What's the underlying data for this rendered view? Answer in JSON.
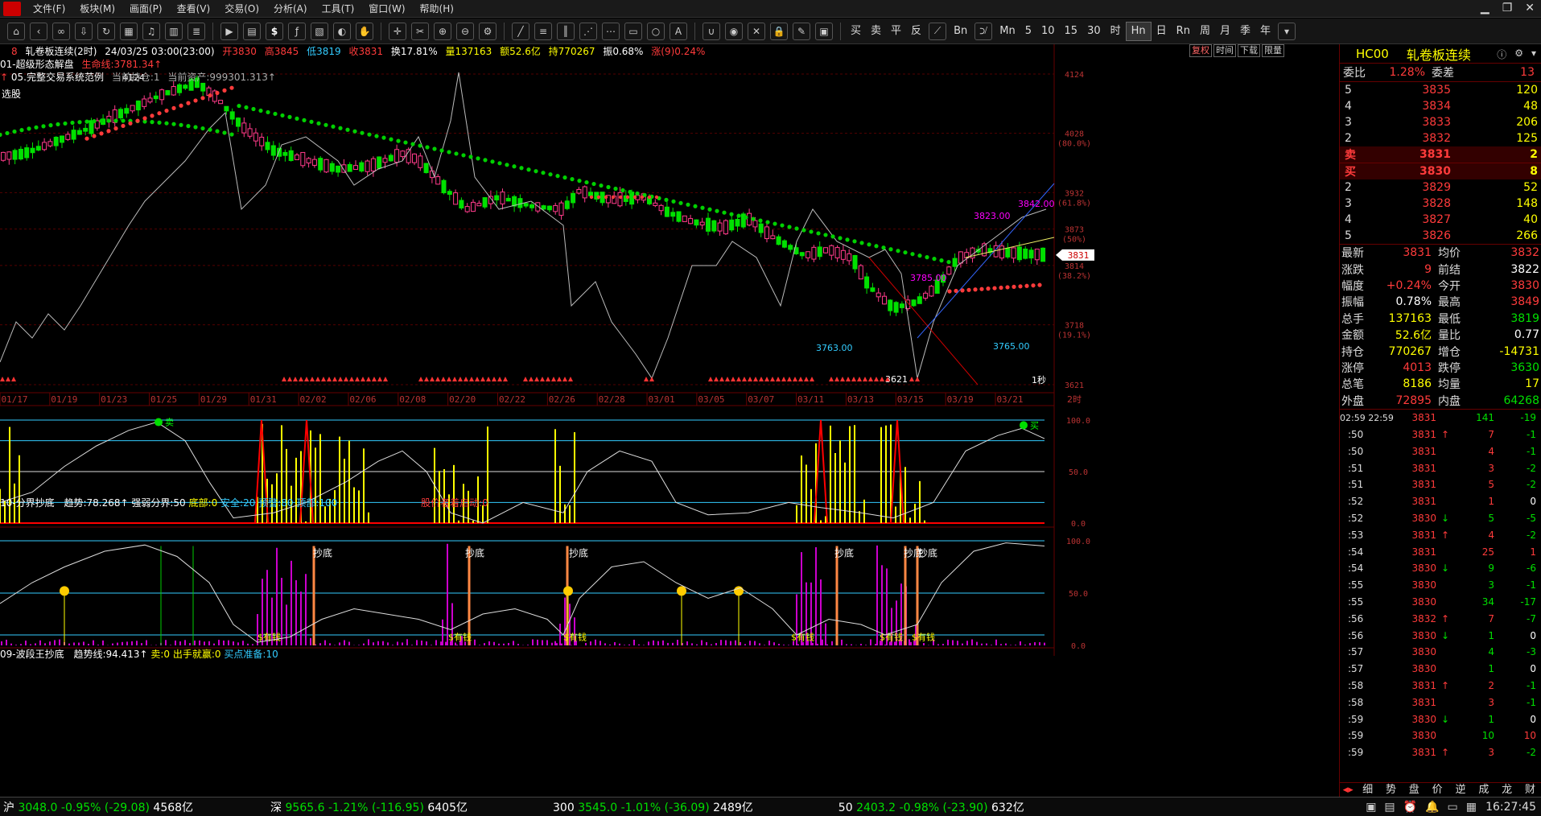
{
  "menu": [
    "文件(F)",
    "板块(M)",
    "画面(P)",
    "查看(V)",
    "交易(O)",
    "分析(A)",
    "工具(T)",
    "窗口(W)",
    "帮助(H)"
  ],
  "toolbar": {
    "periods": [
      "Mn",
      "5",
      "10",
      "15",
      "30",
      "时",
      "Hn",
      "日",
      "Rn",
      "周",
      "月",
      "季",
      "年"
    ],
    "active_period": "Hn",
    "trade": [
      "买",
      "卖",
      "平",
      "反"
    ],
    "quote_icon": "Bn"
  },
  "title": {
    "num": "8",
    "name": "轧卷板连续(2时)",
    "datetime": "24/03/25 03:00(23:00)",
    "open": "开3830",
    "high": "高3845",
    "low": "低3819",
    "close": "收3831",
    "turnover": "换17.81%",
    "volume": "量137163",
    "amount": "额52.6亿",
    "oi": "持770267",
    "amplitude": "振0.68%",
    "change": "涨(9)0.24%"
  },
  "chart_tabs": [
    "复权",
    "时间",
    "下载",
    "限量"
  ],
  "indicator1": {
    "name": "01-超级形态解盘",
    "life": "生命线:3781.34"
  },
  "indicator2": {
    "name": "05.完整交易系统范例",
    "pos": "当前持仓:1",
    "asset": "当前资产:999301.313"
  },
  "xuangu": "选股",
  "price_axis": [
    {
      "v": "4124",
      "p": ""
    },
    {
      "v": "4028",
      "p": "(80.0%)"
    },
    {
      "v": "3932",
      "p": "(61.8%)"
    },
    {
      "v": "3873",
      "p": "(50%)"
    },
    {
      "v": "3814",
      "p": "(38.2%)"
    },
    {
      "v": "3718",
      "p": "(19.1%)"
    },
    {
      "v": "3621",
      "p": ""
    }
  ],
  "current_price_tag": "3831",
  "annotations": {
    "high": "4124",
    "low": "3621",
    "a1": "3763.00",
    "a2": "3765.00",
    "a3": "3823.00",
    "a4": "3842.00",
    "a5": "3785.00",
    "sec": "1秒"
  },
  "dates": [
    "01/17",
    "01/19",
    "01/23",
    "01/25",
    "01/29",
    "01/31",
    "02/02",
    "02/06",
    "02/08",
    "02/20",
    "02/22",
    "02/26",
    "02/28",
    "03/01",
    "03/05",
    "03/07",
    "03/11",
    "03/13",
    "03/15",
    "03/19",
    "03/21"
  ],
  "period_label": "2时",
  "sub1": {
    "name": "10-分界抄底",
    "trend": "趋势:78.268",
    "strong": "强弱分界:50",
    "bottom": "底部:0",
    "safe": "安全:20",
    "warn": "预警:80",
    "top": "顶部:100",
    "start": "股价者着启动:0",
    "axis": [
      "100.0",
      "50.0",
      "0.0"
    ],
    "sell": "卖",
    "buy": "买",
    "mai": "买"
  },
  "sub2": {
    "name": "09-波段王抄底",
    "trend": "趋势线:94.413",
    "sell": "卖:0",
    "out": "出手就赢:0",
    "ready": "买点准备:10",
    "axis": [
      "100.0",
      "50.0",
      "0.0"
    ],
    "chaodi": "抄底",
    "money": "$有钱"
  },
  "right": {
    "code": "HC00",
    "name": "轧卷板连续",
    "weibi_label": "委比",
    "weibi": "1.28%",
    "weicha_label": "委差",
    "weicha": "13",
    "asks": [
      {
        "lvl": "5",
        "p": "3835",
        "v": "120"
      },
      {
        "lvl": "4",
        "p": "3834",
        "v": "48"
      },
      {
        "lvl": "3",
        "p": "3833",
        "v": "206"
      },
      {
        "lvl": "2",
        "p": "3832",
        "v": "125"
      },
      {
        "lvl": "卖",
        "p": "3831",
        "v": "2"
      }
    ],
    "bids": [
      {
        "lvl": "买",
        "p": "3830",
        "v": "8"
      },
      {
        "lvl": "2",
        "p": "3829",
        "v": "52"
      },
      {
        "lvl": "3",
        "p": "3828",
        "v": "148"
      },
      {
        "lvl": "4",
        "p": "3827",
        "v": "40"
      },
      {
        "lvl": "5",
        "p": "3826",
        "v": "266"
      }
    ],
    "quotes": [
      {
        "k1": "最新",
        "v1": "3831",
        "c1": "red",
        "k2": "均价",
        "v2": "3832",
        "c2": "red"
      },
      {
        "k1": "涨跌",
        "v1": "9",
        "c1": "red",
        "k2": "前结",
        "v2": "3822",
        "c2": "white"
      },
      {
        "k1": "幅度",
        "v1": "+0.24%",
        "c1": "red",
        "k2": "今开",
        "v2": "3830",
        "c2": "red"
      },
      {
        "k1": "振幅",
        "v1": "0.78%",
        "c1": "white",
        "k2": "最高",
        "v2": "3849",
        "c2": "red"
      },
      {
        "k1": "总手",
        "v1": "137163",
        "c1": "yellow",
        "k2": "最低",
        "v2": "3819",
        "c2": "green"
      },
      {
        "k1": "金额",
        "v1": "52.6亿",
        "c1": "yellow",
        "k2": "量比",
        "v2": "0.77",
        "c2": "white"
      },
      {
        "k1": "持仓",
        "v1": "770267",
        "c1": "yellow",
        "k2": "增仓",
        "v2": "-14731",
        "c2": "yellow"
      },
      {
        "k1": "涨停",
        "v1": "4013",
        "c1": "red",
        "k2": "跌停",
        "v2": "3630",
        "c2": "green"
      },
      {
        "k1": "总笔",
        "v1": "8186",
        "c1": "yellow",
        "k2": "均量",
        "v2": "17",
        "c2": "yellow"
      },
      {
        "k1": "外盘",
        "v1": "72895",
        "c1": "red",
        "k2": "内盘",
        "v2": "64268",
        "c2": "green"
      }
    ],
    "ticks": [
      {
        "t": "02:59 22:59",
        "p": "3831",
        "pc": "red",
        "a": "",
        "v": "141",
        "vc": "green",
        "d": "-19",
        "dc": "green"
      },
      {
        "t": ":50",
        "p": "3831",
        "pc": "red",
        "a": "↑",
        "ac": "red",
        "v": "7",
        "vc": "red",
        "d": "-1",
        "dc": "green"
      },
      {
        "t": ":50",
        "p": "3831",
        "pc": "red",
        "a": "",
        "v": "4",
        "vc": "red",
        "d": "-1",
        "dc": "green"
      },
      {
        "t": ":51",
        "p": "3831",
        "pc": "red",
        "a": "",
        "v": "3",
        "vc": "red",
        "d": "-2",
        "dc": "green"
      },
      {
        "t": ":51",
        "p": "3831",
        "pc": "red",
        "a": "",
        "v": "5",
        "vc": "red",
        "d": "-2",
        "dc": "green"
      },
      {
        "t": ":52",
        "p": "3831",
        "pc": "red",
        "a": "",
        "v": "1",
        "vc": "red",
        "d": "0",
        "dc": "white"
      },
      {
        "t": ":52",
        "p": "3830",
        "pc": "red",
        "a": "↓",
        "ac": "green",
        "v": "5",
        "vc": "green",
        "d": "-5",
        "dc": "green"
      },
      {
        "t": ":53",
        "p": "3831",
        "pc": "red",
        "a": "↑",
        "ac": "red",
        "v": "4",
        "vc": "red",
        "d": "-2",
        "dc": "green"
      },
      {
        "t": ":54",
        "p": "3831",
        "pc": "red",
        "a": "",
        "v": "25",
        "vc": "red",
        "d": "1",
        "dc": "red"
      },
      {
        "t": ":54",
        "p": "3830",
        "pc": "red",
        "a": "↓",
        "ac": "green",
        "v": "9",
        "vc": "green",
        "d": "-6",
        "dc": "green"
      },
      {
        "t": ":55",
        "p": "3830",
        "pc": "red",
        "a": "",
        "v": "3",
        "vc": "green",
        "d": "-1",
        "dc": "green"
      },
      {
        "t": ":55",
        "p": "3830",
        "pc": "red",
        "a": "",
        "v": "34",
        "vc": "green",
        "d": "-17",
        "dc": "green"
      },
      {
        "t": ":56",
        "p": "3832",
        "pc": "red",
        "a": "↑",
        "ac": "red",
        "v": "7",
        "vc": "red",
        "d": "-7",
        "dc": "green"
      },
      {
        "t": ":56",
        "p": "3830",
        "pc": "red",
        "a": "↓",
        "ac": "green",
        "v": "1",
        "vc": "green",
        "d": "0",
        "dc": "white"
      },
      {
        "t": ":57",
        "p": "3830",
        "pc": "red",
        "a": "",
        "v": "4",
        "vc": "green",
        "d": "-3",
        "dc": "green"
      },
      {
        "t": ":57",
        "p": "3830",
        "pc": "red",
        "a": "",
        "v": "1",
        "vc": "green",
        "d": "0",
        "dc": "white"
      },
      {
        "t": ":58",
        "p": "3831",
        "pc": "red",
        "a": "↑",
        "ac": "red",
        "v": "2",
        "vc": "red",
        "d": "-1",
        "dc": "green"
      },
      {
        "t": ":58",
        "p": "3831",
        "pc": "red",
        "a": "",
        "v": "3",
        "vc": "red",
        "d": "-1",
        "dc": "green"
      },
      {
        "t": ":59",
        "p": "3830",
        "pc": "red",
        "a": "↓",
        "ac": "green",
        "v": "1",
        "vc": "green",
        "d": "0",
        "dc": "white"
      },
      {
        "t": ":59",
        "p": "3830",
        "pc": "red",
        "a": "",
        "v": "10",
        "vc": "green",
        "d": "10",
        "dc": "red"
      },
      {
        "t": ":59",
        "p": "3831",
        "pc": "red",
        "a": "↑",
        "ac": "red",
        "v": "3",
        "vc": "red",
        "d": "-2",
        "dc": "green"
      }
    ],
    "tabs": [
      "细",
      "势",
      "盘",
      "价",
      "逆",
      "成",
      "龙",
      "财"
    ]
  },
  "status": {
    "sh_label": "沪",
    "sh": "3048.0",
    "sh_pct": "-0.95%",
    "sh_chg": "(-29.08)",
    "sh_amt": "4568亿",
    "sz_label": "深",
    "sz": "9565.6",
    "sz_pct": "-1.21%",
    "sz_chg": "(-116.95)",
    "sz_amt": "6405亿",
    "i300_label": "300",
    "i300": "3545.0",
    "i300_pct": "-1.01%",
    "i300_chg": "(-36.09)",
    "i300_amt": "2489亿",
    "i50_label": "50",
    "i50": "2403.2",
    "i50_pct": "-0.98%",
    "i50_chg": "(-23.90)",
    "i50_amt": "632亿",
    "clock": "16:27:45"
  },
  "colors": {
    "up": "#ff3b3b",
    "down": "#00e000",
    "bg": "#000000",
    "grid": "#660000"
  }
}
